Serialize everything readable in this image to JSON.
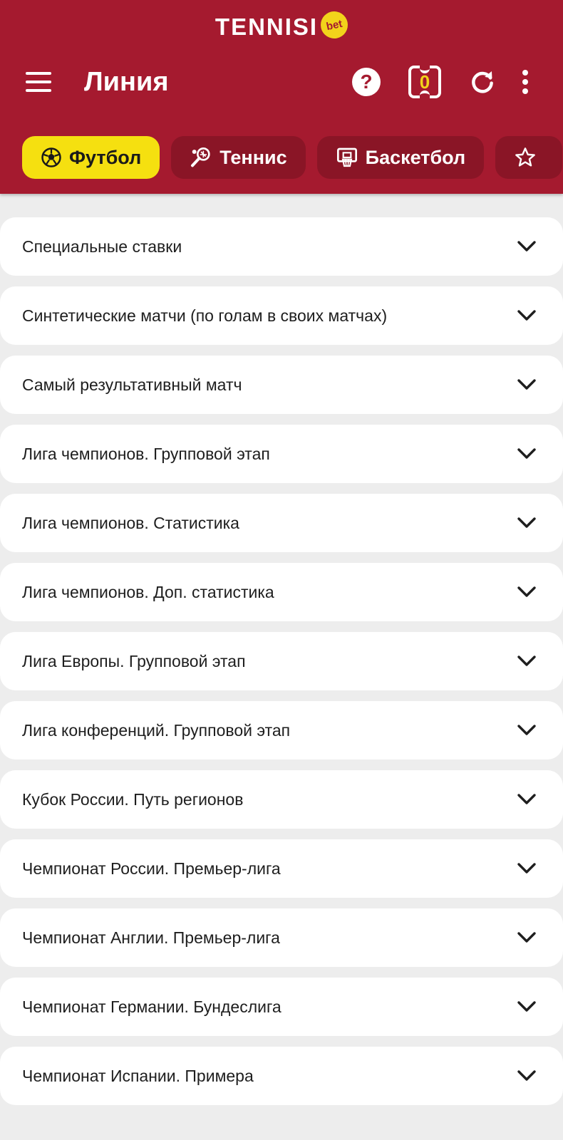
{
  "brand": {
    "name": "TENNISI",
    "badge": "bet"
  },
  "header": {
    "title": "Линия",
    "coupon_count": "0"
  },
  "colors": {
    "header_bg": "#a51a2f",
    "chip_bg": "#8a1526",
    "chip_active_bg": "#f5e010",
    "accent_yellow": "#f2d31b"
  },
  "sports_tabs": [
    {
      "label": "Футбол",
      "icon": "soccer-ball-icon",
      "active": true
    },
    {
      "label": "Теннис",
      "icon": "tennis-racket-icon",
      "active": false
    },
    {
      "label": "Баскетбол",
      "icon": "basketball-hoop-icon",
      "active": false
    },
    {
      "label": "",
      "icon": "star-icon",
      "active": false
    }
  ],
  "leagues": [
    {
      "label": "Специальные ставки"
    },
    {
      "label": "Синтетические матчи (по голам в своих матчах)"
    },
    {
      "label": "Самый результативный матч"
    },
    {
      "label": "Лига чемпионов. Групповой этап"
    },
    {
      "label": "Лига чемпионов. Статистика"
    },
    {
      "label": "Лига чемпионов. Доп. статистика"
    },
    {
      "label": "Лига Европы. Групповой этап"
    },
    {
      "label": "Лига конференций. Групповой этап"
    },
    {
      "label": "Кубок России. Путь регионов"
    },
    {
      "label": "Чемпионат России. Премьер-лига"
    },
    {
      "label": "Чемпионат Англии. Премьер-лига"
    },
    {
      "label": "Чемпионат Германии. Бундеслига"
    },
    {
      "label": "Чемпионат Испании. Примера"
    }
  ]
}
